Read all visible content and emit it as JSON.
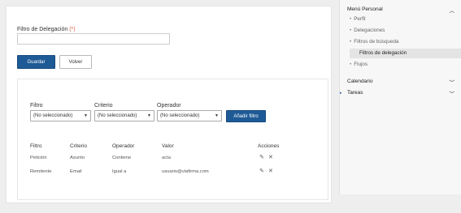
{
  "form": {
    "delegation_filter_label": "Filtro de Delegación",
    "required_marker": "(*)",
    "delegation_filter_value": "",
    "save_label": "Guardar",
    "back_label": "Volver"
  },
  "filters": {
    "filter_label": "Filtro",
    "criterion_label": "Criterio",
    "operator_label": "Operador",
    "filter_select": "(No seleccionado)",
    "criterion_select": "(No seleccionado)",
    "operator_select": "(No seleccionado)",
    "add_filter_label": "Añadir filtro"
  },
  "table": {
    "headers": [
      "Filtro",
      "Criterio",
      "Operador",
      "Valor",
      "Acciones"
    ],
    "rows": [
      [
        "Petición",
        "Asunto",
        "Contiene",
        "acta"
      ],
      [
        "Remitente",
        "Email",
        "Igual a",
        "usuario@viafirma.com"
      ]
    ]
  },
  "sidebar": {
    "menu_title": "Menú Personal",
    "items": [
      "Perfil",
      "Delegaciones",
      "Filtros de búsqueda",
      "Filtros de delegación",
      "Flujos"
    ],
    "calendar": "Calendario",
    "tasks": "Tareas"
  },
  "icons": {
    "edit": "pencil-icon",
    "delete": "close-icon",
    "chevron_up": "chevron-up-icon",
    "chevron_down": "chevron-down-icon"
  },
  "colors": {
    "primary": "#1e5a96",
    "required": "#e05a4a"
  }
}
